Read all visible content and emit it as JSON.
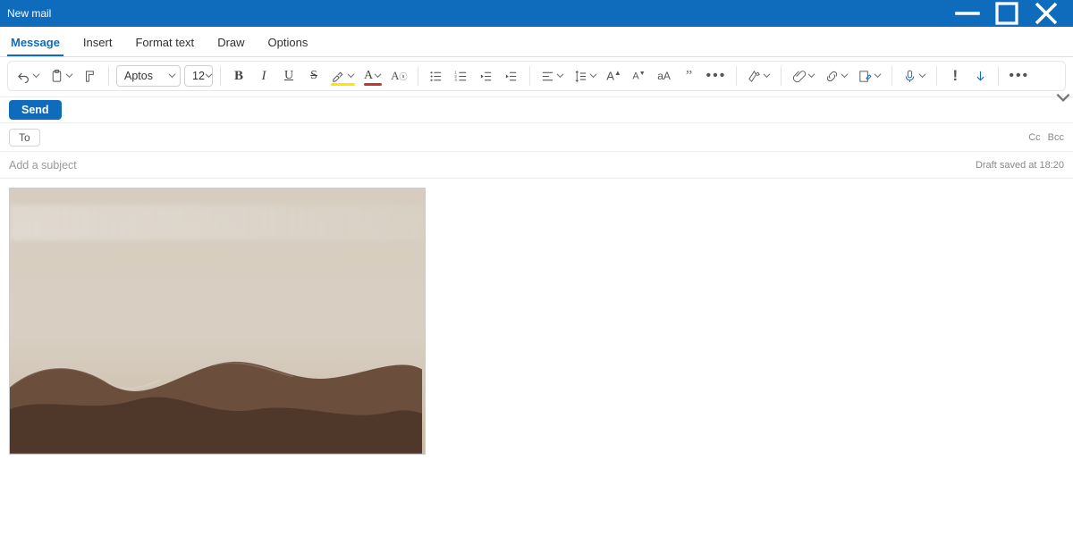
{
  "window": {
    "title": "New mail"
  },
  "tabs": {
    "message": "Message",
    "insert": "Insert",
    "format": "Format text",
    "draw": "Draw",
    "options": "Options",
    "active": "message"
  },
  "ribbon": {
    "font_name": "Aptos",
    "font_size": "12",
    "highlight_color": "#ffe600",
    "font_color": "#c0392b"
  },
  "actions": {
    "send": "Send"
  },
  "recipients": {
    "to_label": "To",
    "cc_label": "Cc",
    "bcc_label": "Bcc"
  },
  "subject": {
    "placeholder": "Add a subject",
    "value": ""
  },
  "status": {
    "draft_saved": "Draft saved at 18:20"
  },
  "body": {
    "has_desert_image": true
  },
  "colors": {
    "accent": "#0f6cbd"
  }
}
